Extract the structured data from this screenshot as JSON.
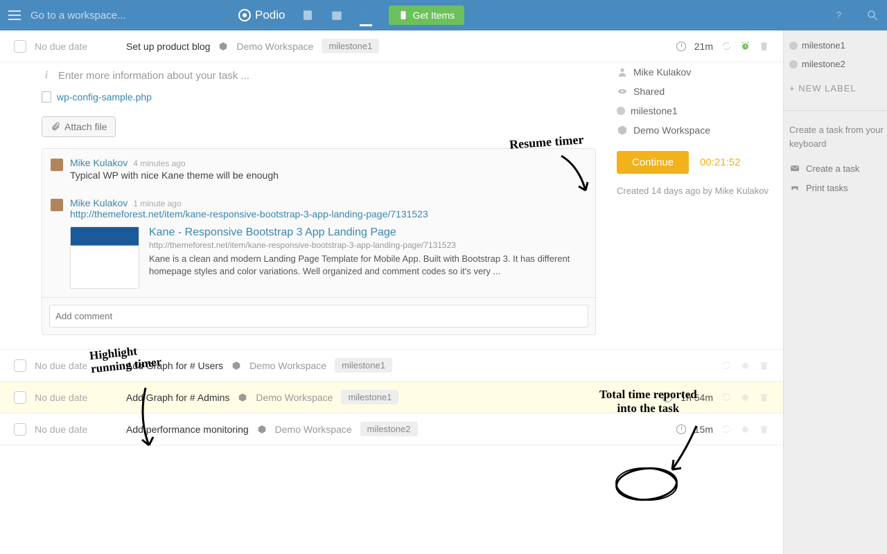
{
  "topbar": {
    "workspace_placeholder": "Go to a workspace...",
    "brand": "Podio",
    "get_items": "Get Items"
  },
  "tasks": [
    {
      "due": "No due date",
      "title": "Set up product blog",
      "workspace": "Demo Workspace",
      "tag": "milestone1",
      "time": "21m",
      "alarm_active": true
    },
    {
      "due": "No due date",
      "title": "Add Graph for # Users",
      "workspace": "Demo Workspace",
      "tag": "milestone1",
      "time": ""
    },
    {
      "due": "No due date",
      "title": "Add Graph for # Admins",
      "workspace": "Demo Workspace",
      "tag": "milestone1",
      "time": "1h 54m",
      "highlight": true
    },
    {
      "due": "No due date",
      "title": "Add performance monitoring",
      "workspace": "Demo Workspace",
      "tag": "milestone2",
      "time": "15m"
    }
  ],
  "expanded": {
    "info_placeholder": "Enter more information about your task ...",
    "file_name": "wp-config-sample.php",
    "attach_label": "Attach file",
    "comments": [
      {
        "author": "Mike Kulakov",
        "ago": "4 minutes ago",
        "text": "Typical WP with nice Kane theme will be enough"
      },
      {
        "author": "Mike Kulakov",
        "ago": "1 minute ago",
        "link": "http://themeforest.net/item/kane-responsive-bootstrap-3-app-landing-page/7131523"
      }
    ],
    "preview": {
      "title": "Kane - Responsive Bootstrap 3 App Landing Page",
      "url": "http://themeforest.net/item/kane-responsive-bootstrap-3-app-landing-page/7131523",
      "desc": "Kane is a clean and modern Landing Page Template for Mobile App. Built with Bootstrap 3. It has different homepage styles and color variations. Well organized and comment codes so it's very ..."
    },
    "add_comment_placeholder": "Add comment",
    "meta": {
      "user": "Mike Kulakov",
      "shared": "Shared",
      "label": "milestone1",
      "workspace": "Demo Workspace"
    },
    "continue_label": "Continue",
    "timer": "00:21:52",
    "created": "Created 14 days ago by Mike Kulakov"
  },
  "sidebar": {
    "labels": [
      "milestone1",
      "milestone2"
    ],
    "new_label": "+ NEW LABEL",
    "hint": "Create a task from your keyboard",
    "create_task": "Create a task",
    "print_tasks": "Print tasks"
  },
  "annotations": {
    "resume": "Resume timer",
    "highlight": "Highlight\nrunning timer",
    "total": "Total time reported\ninto the task"
  }
}
